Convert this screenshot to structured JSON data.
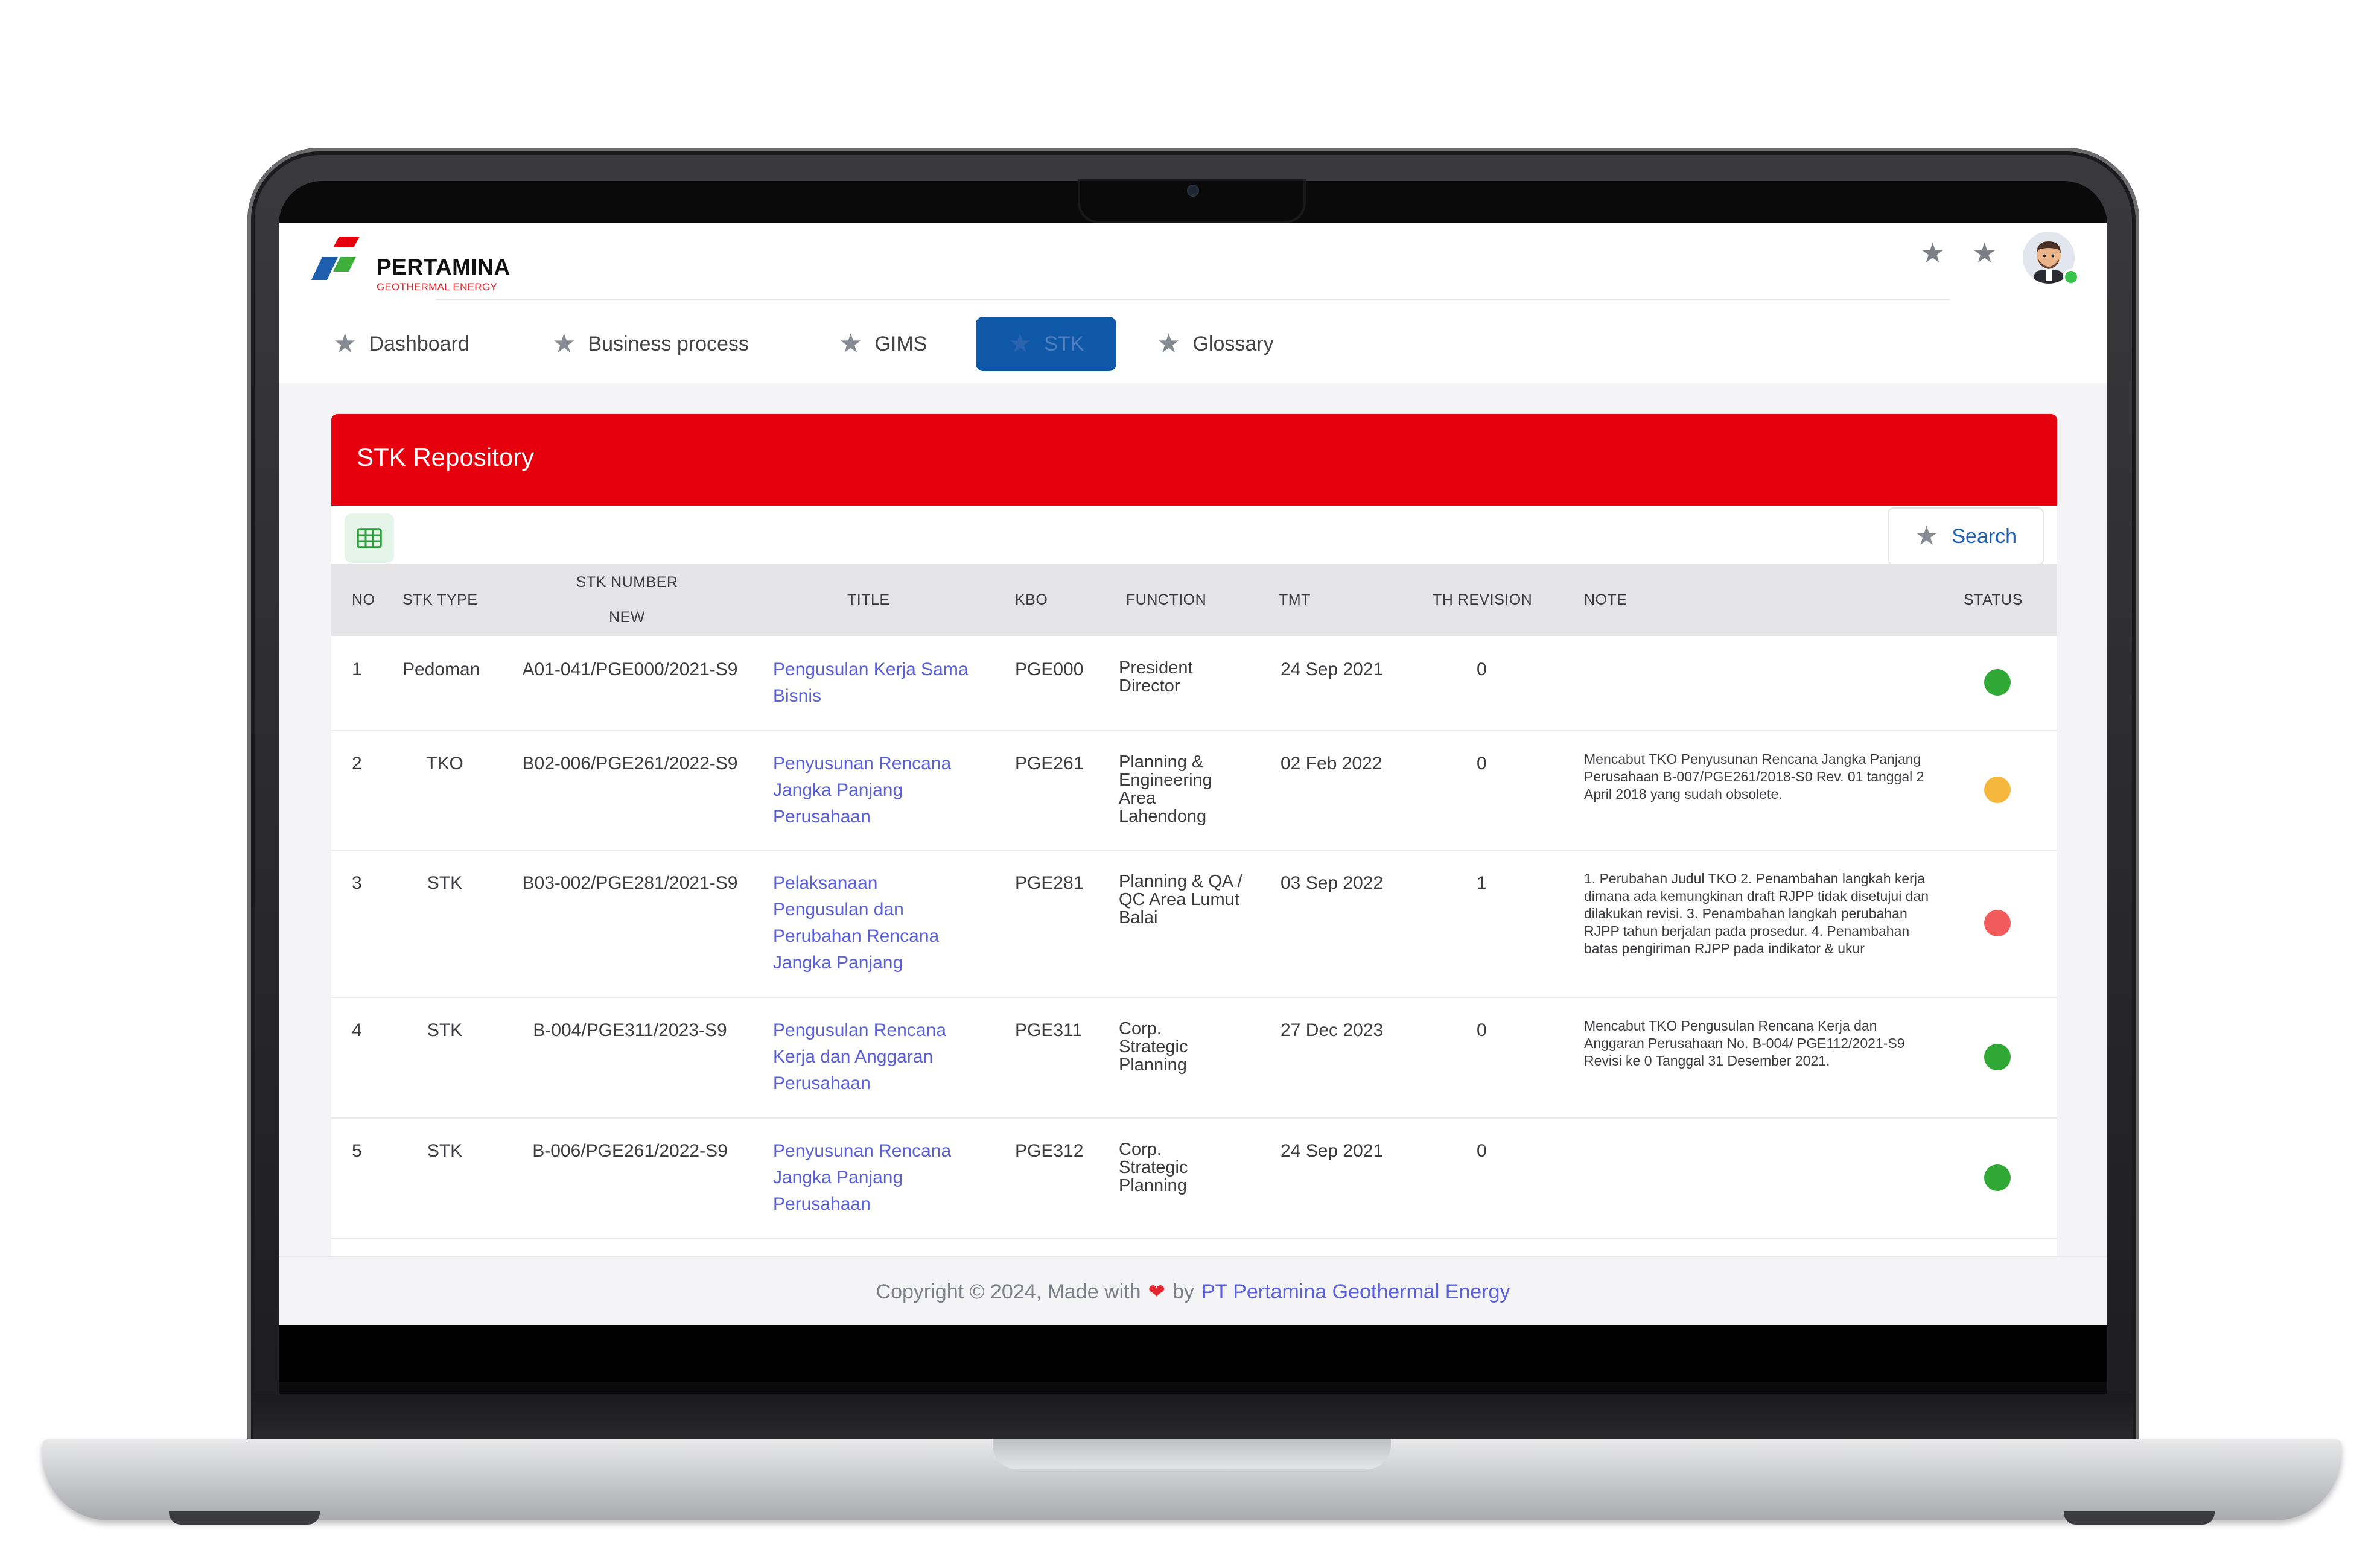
{
  "brand": {
    "name": "PERTAMINA",
    "subtitle": "GEOTHERMAL ENERGY",
    "colors": {
      "red": "#e6000e",
      "blue": "#1d5fae",
      "green": "#2d9d3d"
    }
  },
  "header": {
    "icons": [
      "star-icon",
      "star-icon"
    ],
    "avatar": "user-avatar"
  },
  "nav": {
    "items": [
      {
        "label": "Dashboard",
        "icon": "star-icon"
      },
      {
        "label": "Business process",
        "icon": "star-icon"
      },
      {
        "label": "GIMS",
        "icon": "star-icon"
      },
      {
        "label": "STK",
        "icon": "star-icon",
        "active": true
      },
      {
        "label": "Glossary",
        "icon": "star-icon"
      }
    ],
    "active_color": "#0f58a8"
  },
  "card": {
    "title": "STK Repository",
    "toolbar": {
      "grid_icon": "grid-icon",
      "search_label": "Search"
    }
  },
  "table": {
    "headers": {
      "no": "NO",
      "stk_type": "STK TYPE",
      "stk_number": "STK NUMBER",
      "stk_number_sub": "NEW",
      "title": "TITLE",
      "kbo": "KBO",
      "function": "FUNCTION",
      "tmt": "TMT",
      "th_revision": "TH REVISION",
      "note": "NOTE",
      "status": "STATUS"
    },
    "rows": [
      {
        "no": "1",
        "stk_type": "Pedoman",
        "stk_number": "A01-041/PGE000/2021-S9",
        "title": "Pengusulan Kerja Sama Bisnis",
        "kbo": "PGE000",
        "function": "President Director",
        "tmt": "24 Sep 2021",
        "th_revision": "0",
        "note": "",
        "status_color": "#2fa835"
      },
      {
        "no": "2",
        "stk_type": "TKO",
        "stk_number": "B02-006/PGE261/2022-S9",
        "title": "Penyusunan Rencana Jangka Panjang Perusahaan",
        "kbo": "PGE261",
        "function": "Planning & Engineering Area Lahendong",
        "tmt": "02 Feb 2022",
        "th_revision": "0",
        "note": "Mencabut TKO Penyusunan Rencana Jangka Panjang Perusahaan B-007/PGE261/2018-S0 Rev. 01 tanggal 2 April 2018 yang sudah obsolete.",
        "status_color": "#f5b83d"
      },
      {
        "no": "3",
        "stk_type": "STK",
        "stk_number": "B03-002/PGE281/2021-S9",
        "title": "Pelaksanaan Pengusulan dan Perubahan Rencana Jangka Panjang",
        "kbo": "PGE281",
        "function": "Planning & QA / QC Area Lumut Balai",
        "tmt": "03 Sep 2022",
        "th_revision": "1",
        "note": "1. Perubahan Judul TKO 2. Penambahan langkah kerja dimana ada kemungkinan draft RJPP tidak disetujui dan dilakukan revisi. 3. Penambahan langkah perubahan RJPP tahun berjalan pada prosedur. 4. Penambahan batas pengiriman RJPP pada indikator & ukur",
        "status_color": "#f15b5b"
      },
      {
        "no": "4",
        "stk_type": "STK",
        "stk_number": "B-004/PGE311/2023-S9",
        "title": "Pengusulan Rencana Kerja dan Anggaran Perusahaan",
        "kbo": "PGE311",
        "function": "Corp. Strategic Planning",
        "tmt": "27 Dec 2023",
        "th_revision": "0",
        "note": "Mencabut TKO Pengusulan Rencana Kerja dan Anggaran Perusahaan No. B-004/ PGE112/2021-S9 Revisi ke 0 Tanggal 31 Desember 2021.",
        "status_color": "#2fa835"
      },
      {
        "no": "5",
        "stk_type": "STK",
        "stk_number": "B-006/PGE261/2022-S9",
        "title": "Penyusunan Rencana Jangka Panjang Perusahaan",
        "kbo": "PGE312",
        "function": "Corp. Strategic Planning",
        "tmt": "24 Sep 2021",
        "th_revision": "0",
        "note": "",
        "status_color": "#2fa835"
      }
    ]
  },
  "footer": {
    "prefix": "Copyright © 2024, Made with",
    "heart_icon": "heart-icon",
    "by": "by",
    "company": "PT Pertamina Geothermal Energy"
  }
}
